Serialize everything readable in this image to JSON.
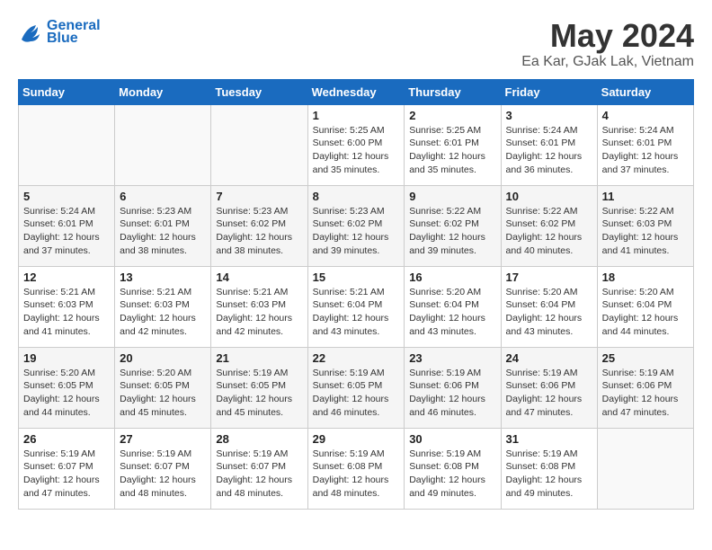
{
  "header": {
    "logo_line1": "General",
    "logo_line2": "Blue",
    "title": "May 2024",
    "subtitle": "Ea Kar, GJak Lak, Vietnam"
  },
  "days_of_week": [
    "Sunday",
    "Monday",
    "Tuesday",
    "Wednesday",
    "Thursday",
    "Friday",
    "Saturday"
  ],
  "weeks": [
    [
      {
        "day": "",
        "info": ""
      },
      {
        "day": "",
        "info": ""
      },
      {
        "day": "",
        "info": ""
      },
      {
        "day": "1",
        "info": "Sunrise: 5:25 AM\nSunset: 6:00 PM\nDaylight: 12 hours\nand 35 minutes."
      },
      {
        "day": "2",
        "info": "Sunrise: 5:25 AM\nSunset: 6:01 PM\nDaylight: 12 hours\nand 35 minutes."
      },
      {
        "day": "3",
        "info": "Sunrise: 5:24 AM\nSunset: 6:01 PM\nDaylight: 12 hours\nand 36 minutes."
      },
      {
        "day": "4",
        "info": "Sunrise: 5:24 AM\nSunset: 6:01 PM\nDaylight: 12 hours\nand 37 minutes."
      }
    ],
    [
      {
        "day": "5",
        "info": "Sunrise: 5:24 AM\nSunset: 6:01 PM\nDaylight: 12 hours\nand 37 minutes."
      },
      {
        "day": "6",
        "info": "Sunrise: 5:23 AM\nSunset: 6:01 PM\nDaylight: 12 hours\nand 38 minutes."
      },
      {
        "day": "7",
        "info": "Sunrise: 5:23 AM\nSunset: 6:02 PM\nDaylight: 12 hours\nand 38 minutes."
      },
      {
        "day": "8",
        "info": "Sunrise: 5:23 AM\nSunset: 6:02 PM\nDaylight: 12 hours\nand 39 minutes."
      },
      {
        "day": "9",
        "info": "Sunrise: 5:22 AM\nSunset: 6:02 PM\nDaylight: 12 hours\nand 39 minutes."
      },
      {
        "day": "10",
        "info": "Sunrise: 5:22 AM\nSunset: 6:02 PM\nDaylight: 12 hours\nand 40 minutes."
      },
      {
        "day": "11",
        "info": "Sunrise: 5:22 AM\nSunset: 6:03 PM\nDaylight: 12 hours\nand 41 minutes."
      }
    ],
    [
      {
        "day": "12",
        "info": "Sunrise: 5:21 AM\nSunset: 6:03 PM\nDaylight: 12 hours\nand 41 minutes."
      },
      {
        "day": "13",
        "info": "Sunrise: 5:21 AM\nSunset: 6:03 PM\nDaylight: 12 hours\nand 42 minutes."
      },
      {
        "day": "14",
        "info": "Sunrise: 5:21 AM\nSunset: 6:03 PM\nDaylight: 12 hours\nand 42 minutes."
      },
      {
        "day": "15",
        "info": "Sunrise: 5:21 AM\nSunset: 6:04 PM\nDaylight: 12 hours\nand 43 minutes."
      },
      {
        "day": "16",
        "info": "Sunrise: 5:20 AM\nSunset: 6:04 PM\nDaylight: 12 hours\nand 43 minutes."
      },
      {
        "day": "17",
        "info": "Sunrise: 5:20 AM\nSunset: 6:04 PM\nDaylight: 12 hours\nand 43 minutes."
      },
      {
        "day": "18",
        "info": "Sunrise: 5:20 AM\nSunset: 6:04 PM\nDaylight: 12 hours\nand 44 minutes."
      }
    ],
    [
      {
        "day": "19",
        "info": "Sunrise: 5:20 AM\nSunset: 6:05 PM\nDaylight: 12 hours\nand 44 minutes."
      },
      {
        "day": "20",
        "info": "Sunrise: 5:20 AM\nSunset: 6:05 PM\nDaylight: 12 hours\nand 45 minutes."
      },
      {
        "day": "21",
        "info": "Sunrise: 5:19 AM\nSunset: 6:05 PM\nDaylight: 12 hours\nand 45 minutes."
      },
      {
        "day": "22",
        "info": "Sunrise: 5:19 AM\nSunset: 6:05 PM\nDaylight: 12 hours\nand 46 minutes."
      },
      {
        "day": "23",
        "info": "Sunrise: 5:19 AM\nSunset: 6:06 PM\nDaylight: 12 hours\nand 46 minutes."
      },
      {
        "day": "24",
        "info": "Sunrise: 5:19 AM\nSunset: 6:06 PM\nDaylight: 12 hours\nand 47 minutes."
      },
      {
        "day": "25",
        "info": "Sunrise: 5:19 AM\nSunset: 6:06 PM\nDaylight: 12 hours\nand 47 minutes."
      }
    ],
    [
      {
        "day": "26",
        "info": "Sunrise: 5:19 AM\nSunset: 6:07 PM\nDaylight: 12 hours\nand 47 minutes."
      },
      {
        "day": "27",
        "info": "Sunrise: 5:19 AM\nSunset: 6:07 PM\nDaylight: 12 hours\nand 48 minutes."
      },
      {
        "day": "28",
        "info": "Sunrise: 5:19 AM\nSunset: 6:07 PM\nDaylight: 12 hours\nand 48 minutes."
      },
      {
        "day": "29",
        "info": "Sunrise: 5:19 AM\nSunset: 6:08 PM\nDaylight: 12 hours\nand 48 minutes."
      },
      {
        "day": "30",
        "info": "Sunrise: 5:19 AM\nSunset: 6:08 PM\nDaylight: 12 hours\nand 49 minutes."
      },
      {
        "day": "31",
        "info": "Sunrise: 5:19 AM\nSunset: 6:08 PM\nDaylight: 12 hours\nand 49 minutes."
      },
      {
        "day": "",
        "info": ""
      }
    ]
  ]
}
